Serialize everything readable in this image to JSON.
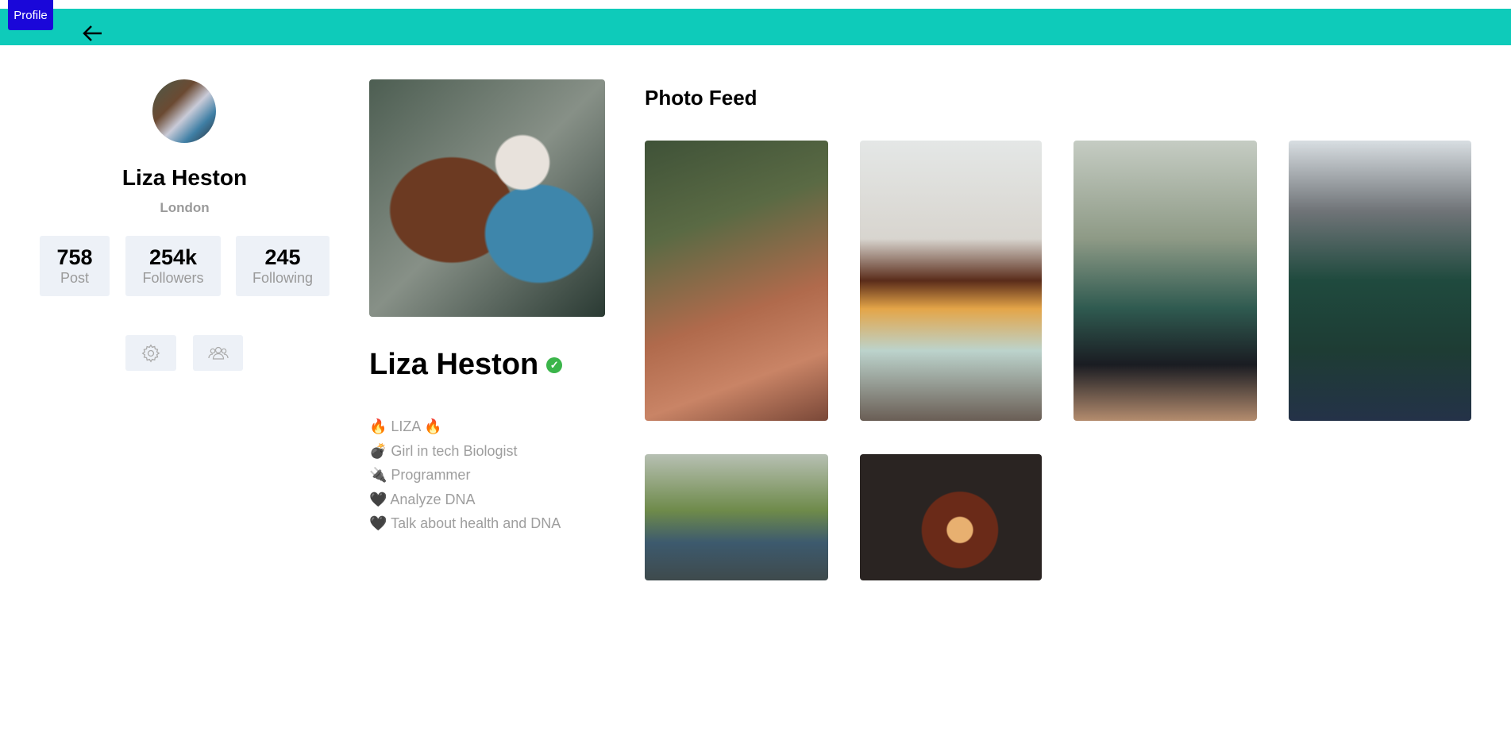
{
  "header": {
    "badge": "Profile",
    "back_icon": "arrow-left-icon",
    "color": "#0ecbba"
  },
  "sidebar": {
    "name": "Liza Heston",
    "location": "London",
    "stats": [
      {
        "value": "758",
        "label": "Post"
      },
      {
        "value": "254k",
        "label": "Followers"
      },
      {
        "value": "245",
        "label": "Following"
      }
    ],
    "buttons": [
      "gear-icon",
      "users-icon"
    ]
  },
  "profile": {
    "name": "Liza Heston",
    "verified": true,
    "bio": [
      "🔥 LIZA 🔥",
      "💣 Girl in tech Biologist",
      "🔌 Programmer",
      "🖤 Analyze DNA",
      "🖤 Talk about health and DNA"
    ]
  },
  "feed": {
    "title": "Photo Feed",
    "photos": [
      "canyon hiker",
      "coffee and candles",
      "dog with toy",
      "woman with pot on head",
      "person sitting outdoors",
      "bacon and eggs"
    ]
  }
}
